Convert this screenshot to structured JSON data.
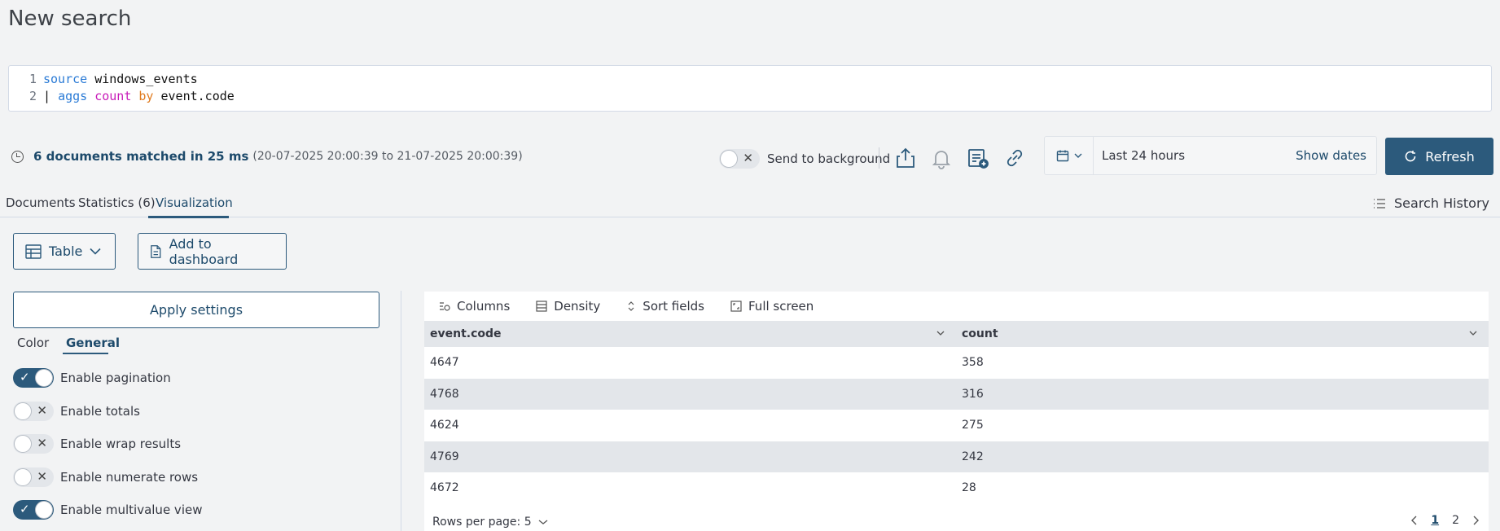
{
  "page": {
    "title": "New search"
  },
  "editor": {
    "lines": [
      {
        "num": "1",
        "kw1": "source",
        "rest": " windows_events"
      },
      {
        "num": "2",
        "pipe": "| ",
        "kw1": "aggs",
        "sp1": " ",
        "kw2": "count",
        "sp2": " ",
        "kw3": "by",
        "rest": " event.code"
      }
    ]
  },
  "stats": {
    "matched": "6 documents matched in 25 ms",
    "range": "(20-07-2025 20:00:39 to 21-07-2025 20:00:39)"
  },
  "toolbar": {
    "send_to_background": "Send to background"
  },
  "daterange": {
    "value": "Last 24 hours",
    "show_dates": "Show dates"
  },
  "refresh": {
    "label": "Refresh"
  },
  "tabs": [
    {
      "label": "Documents"
    },
    {
      "label": "Statistics (6)"
    },
    {
      "label": "Visualization"
    }
  ],
  "search_history": "Search History",
  "visualization": {
    "type_label": "Table",
    "add_dashboard": "Add to dashboard"
  },
  "settings": {
    "apply": "Apply settings",
    "subtabs": [
      "Color",
      "General"
    ],
    "options": [
      {
        "label": "Enable pagination",
        "on": true
      },
      {
        "label": "Enable totals",
        "on": false
      },
      {
        "label": "Enable wrap results",
        "on": false
      },
      {
        "label": "Enable numerate rows",
        "on": false
      },
      {
        "label": "Enable multivalue view",
        "on": true
      }
    ]
  },
  "table": {
    "toolbar": [
      "Columns",
      "Density",
      "Sort fields",
      "Full screen"
    ],
    "columns": [
      "event.code",
      "count"
    ],
    "rows": [
      [
        "4647",
        "358"
      ],
      [
        "4768",
        "316"
      ],
      [
        "4624",
        "275"
      ],
      [
        "4769",
        "242"
      ],
      [
        "4672",
        "28"
      ]
    ],
    "rows_per_page": "Rows per page: 5",
    "pages": [
      "1",
      "2"
    ]
  }
}
